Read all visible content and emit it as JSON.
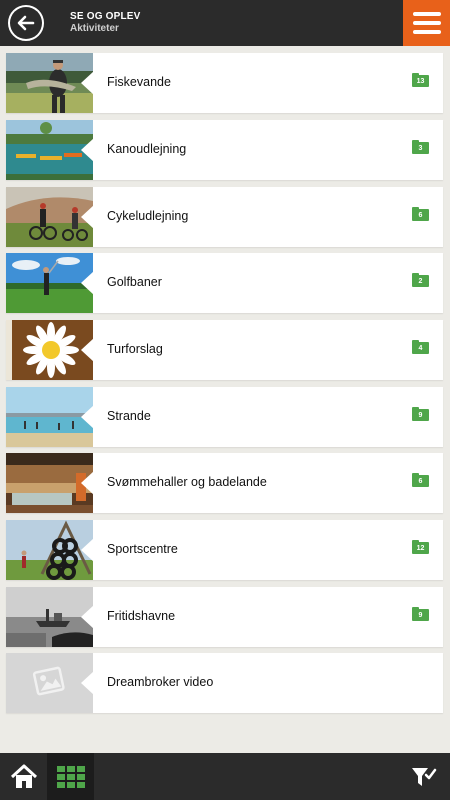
{
  "header": {
    "title": "SE OG OPLEV",
    "subtitle": "Aktiviteter",
    "back_icon": "arrow-left-icon",
    "menu_icon": "hamburger-menu-icon",
    "menu_color": "#e8611a"
  },
  "items": [
    {
      "label": "Fiskevande",
      "count": "13",
      "image": "fisherman-photo"
    },
    {
      "label": "Kanoudlejning",
      "count": "3",
      "image": "canoes-on-lake-photo"
    },
    {
      "label": "Cykeludlejning",
      "count": "6",
      "image": "cyclists-photo"
    },
    {
      "label": "Golfbaner",
      "count": "2",
      "image": "golfer-photo"
    },
    {
      "label": "Turforslag",
      "count": "4",
      "image": "daisy-sign-photo"
    },
    {
      "label": "Strande",
      "count": "9",
      "image": "beach-photo"
    },
    {
      "label": "Svømmehaller og badelande",
      "count": "6",
      "image": "swimming-hall-photo"
    },
    {
      "label": "Sportscentre",
      "count": "12",
      "image": "tire-climbing-frame-photo"
    },
    {
      "label": "Fritidshavne",
      "count": "9",
      "image": "harbour-boat-photo"
    },
    {
      "label": "Dreambroker video",
      "count": "",
      "image": "image-placeholder-icon"
    }
  ],
  "bottom_bar": {
    "home_icon": "home-icon",
    "grid_icon": "grid-view-icon",
    "filter_icon": "filter-check-icon",
    "accent": "#4fa64a"
  }
}
